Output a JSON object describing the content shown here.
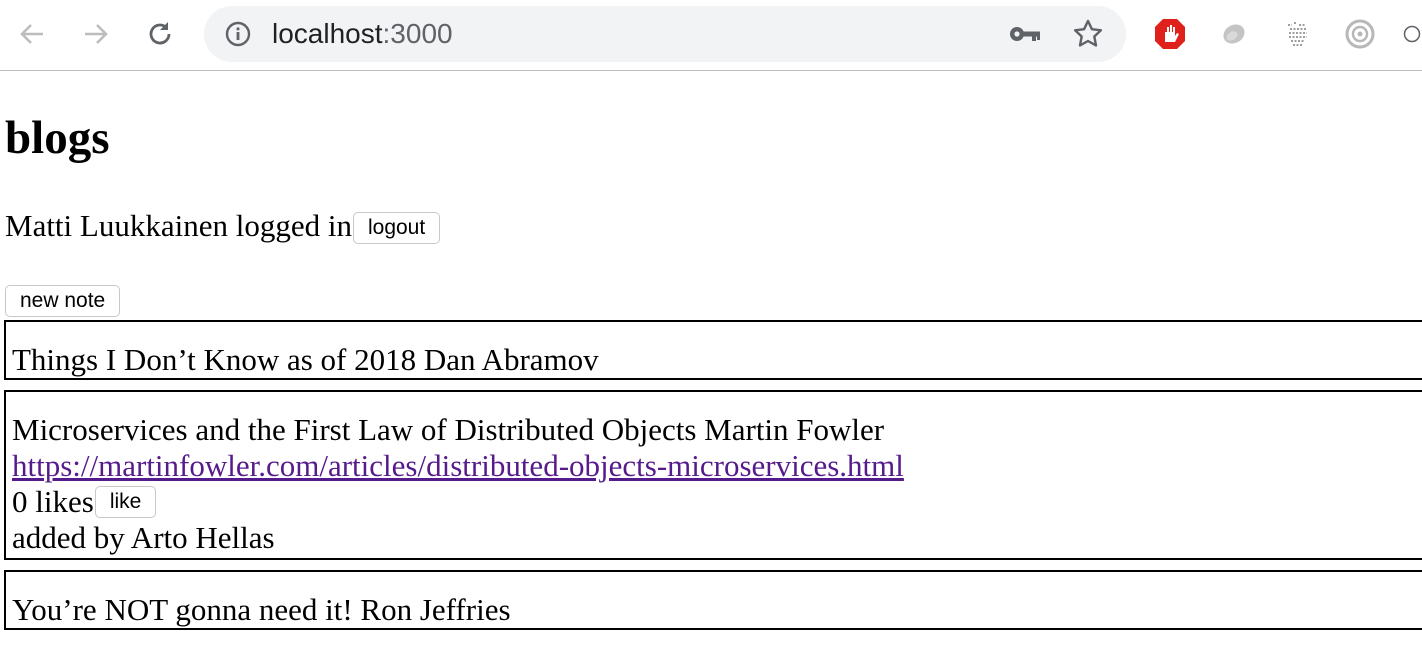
{
  "browser": {
    "url_host": "localhost",
    "url_port": ":3000"
  },
  "page": {
    "heading": "blogs",
    "user_status": "Matti Luukkainen logged in",
    "logout_label": "logout",
    "new_note_label": "new note"
  },
  "blogs": [
    {
      "title_author": "Things I Don’t Know as of 2018 Dan Abramov"
    },
    {
      "title_author": "Microservices and the First Law of Distributed Objects Martin Fowler",
      "url": "https://martinfowler.com/articles/distributed-objects-microservices.html",
      "likes_text": "0 likes",
      "like_label": "like",
      "added_by": "added by Arto Hellas"
    },
    {
      "title_author": "You’re NOT gonna need it! Ron Jeffries"
    }
  ]
}
